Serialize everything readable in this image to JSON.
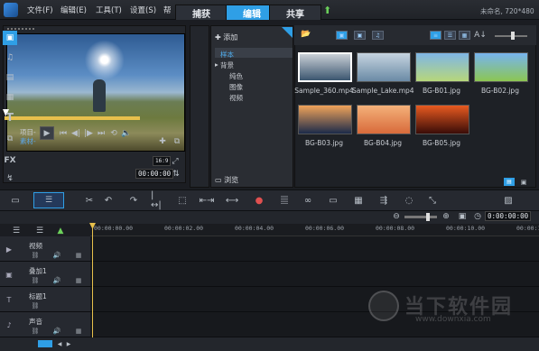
{
  "menubar": {
    "items": [
      "文件(F)",
      "编辑(E)",
      "工具(T)",
      "设置(S)",
      "帮"
    ]
  },
  "tabs": [
    {
      "label": "捕获",
      "active": false
    },
    {
      "label": "编辑",
      "active": true
    },
    {
      "label": "共享",
      "active": false
    }
  ],
  "window_title": "未命名, 720*480",
  "player": {
    "project_label": "项目-",
    "clip_label": "素材-",
    "zoom_value": "16:9",
    "timecode": "00:00:00"
  },
  "library": {
    "add_label": "添加",
    "tree": [
      {
        "label": "样本",
        "level": 0,
        "selected": true
      },
      {
        "label": "背景",
        "level": 0,
        "expanded": true
      },
      {
        "label": "纯色",
        "level": 1
      },
      {
        "label": "图像",
        "level": 1
      },
      {
        "label": "视频",
        "level": 1
      }
    ],
    "browse_label": "浏览",
    "thumbnails": [
      {
        "name": "Sample_360.mp4",
        "selected": true,
        "colors": [
          "#c9cfd6",
          "#3b566f"
        ]
      },
      {
        "name": "Sample_Lake.mp4",
        "selected": false,
        "colors": [
          "#c6d4e0",
          "#6a8aa5"
        ]
      },
      {
        "name": "BG-B01.jpg",
        "selected": false,
        "colors": [
          "#7fb6e6",
          "#b7d77a"
        ]
      },
      {
        "name": "BG-B02.jpg",
        "selected": false,
        "colors": [
          "#77b4f0",
          "#8cc652"
        ]
      },
      {
        "name": "BG-B03.jpg",
        "selected": false,
        "colors": [
          "#f0a35a",
          "#1b2a4a"
        ]
      },
      {
        "name": "BG-B04.jpg",
        "selected": false,
        "colors": [
          "#f4b17a",
          "#d86a3a"
        ]
      },
      {
        "name": "BG-B05.jpg",
        "selected": false,
        "colors": [
          "#e85a20",
          "#3a0c08"
        ]
      }
    ]
  },
  "timeline": {
    "zoom_timecode": "0:00:00:00",
    "ruler": [
      "00:00:00.00",
      "00:00:02.00",
      "00:00:04.00",
      "00:00:06.00",
      "00:00:08.00",
      "00:00:10.00",
      "00:00:12"
    ],
    "tracks": [
      {
        "name": "视频",
        "icon": "video-track-icon"
      },
      {
        "name": "叠加1",
        "icon": "overlay-track-icon"
      },
      {
        "name": "标题1",
        "icon": "title-track-icon"
      },
      {
        "name": "声音",
        "icon": "voice-track-icon"
      }
    ]
  },
  "watermark": {
    "text": "当下软件园",
    "url": "www.downxia.com"
  },
  "colors": {
    "accent": "#2f9fe6",
    "scrub": "#e7c04c",
    "tab_inactive": "#2c3038"
  }
}
